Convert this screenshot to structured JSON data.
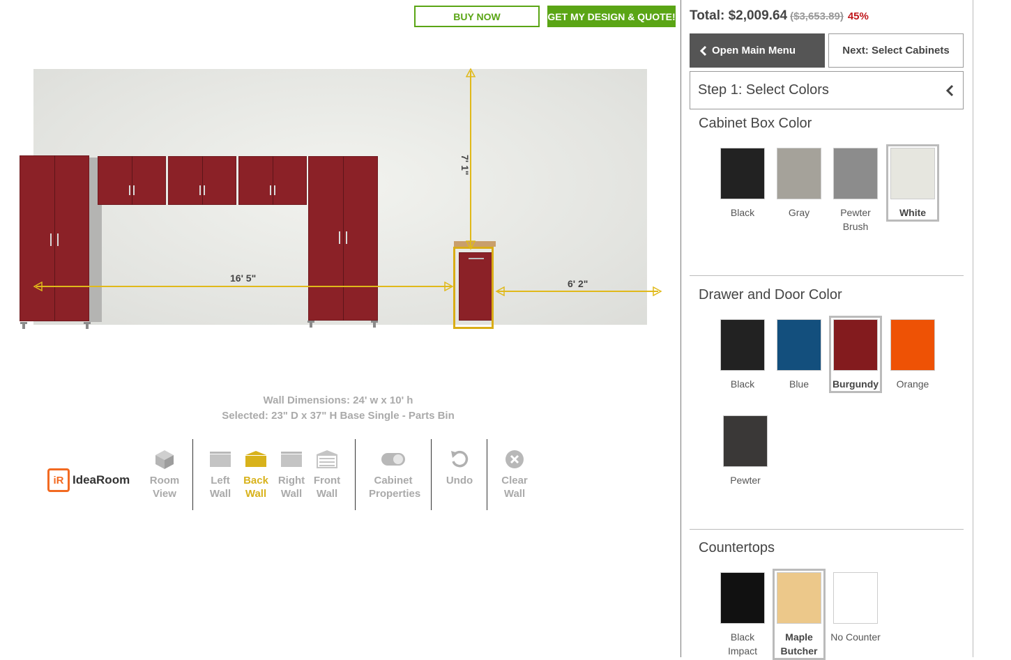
{
  "header": {
    "buy_now": "BUY NOW",
    "get_quote": "GET MY DESIGN & QUOTE!"
  },
  "scene": {
    "dim_width": "16' 5\"",
    "dim_height": "7' 1\"",
    "dim_right": "6' 2\""
  },
  "info": {
    "wall_dimensions": "Wall Dimensions: 24' w x 10' h",
    "selected": "Selected: 23\" D x 37\" H Base Single - Parts Bin"
  },
  "toolbar": {
    "logo": {
      "mark": "iR",
      "idea": "Idea",
      "room": "Room"
    },
    "room_view": [
      "Room",
      "View"
    ],
    "left_wall": [
      "Left",
      "Wall"
    ],
    "back_wall": [
      "Back",
      "Wall"
    ],
    "right_wall": [
      "Right",
      "Wall"
    ],
    "front_wall": [
      "Front",
      "Wall"
    ],
    "cabinet_properties": [
      "Cabinet",
      "Properties"
    ],
    "undo": "Undo",
    "clear_wall": [
      "Clear",
      "Wall"
    ]
  },
  "panel": {
    "total_label": "Total: $2,009.64",
    "original_price": "($3,653.89)",
    "discount": "45%",
    "open_menu": "Open Main Menu",
    "next": "Next: Select Cabinets",
    "step": "Step 1: Select Colors",
    "box_color_title": "Cabinet Box Color",
    "box_colors": [
      {
        "label": "Black",
        "color": "#222222"
      },
      {
        "label": "Gray",
        "color": "#a5a29a"
      },
      {
        "label": "Pewter Brush",
        "color": "#8c8c8c"
      },
      {
        "label": "White",
        "color": "#e6e6df",
        "selected": true
      }
    ],
    "door_color_title": "Drawer and Door Color",
    "door_colors": [
      {
        "label": "Black",
        "color": "#222222"
      },
      {
        "label": "Blue",
        "color": "#134f7d"
      },
      {
        "label": "Burgundy",
        "color": "#831b1e",
        "selected": true
      },
      {
        "label": "Orange",
        "color": "#ee5205"
      },
      {
        "label": "Pewter",
        "color": "#3a3837"
      }
    ],
    "countertops_title": "Countertops",
    "countertops": [
      {
        "label": "Black Impact",
        "color": "#111111"
      },
      {
        "label": "Maple Butcher",
        "color": "#ecc88a",
        "selected": true
      },
      {
        "label": "No Counter",
        "color": "#ffffff"
      }
    ]
  }
}
